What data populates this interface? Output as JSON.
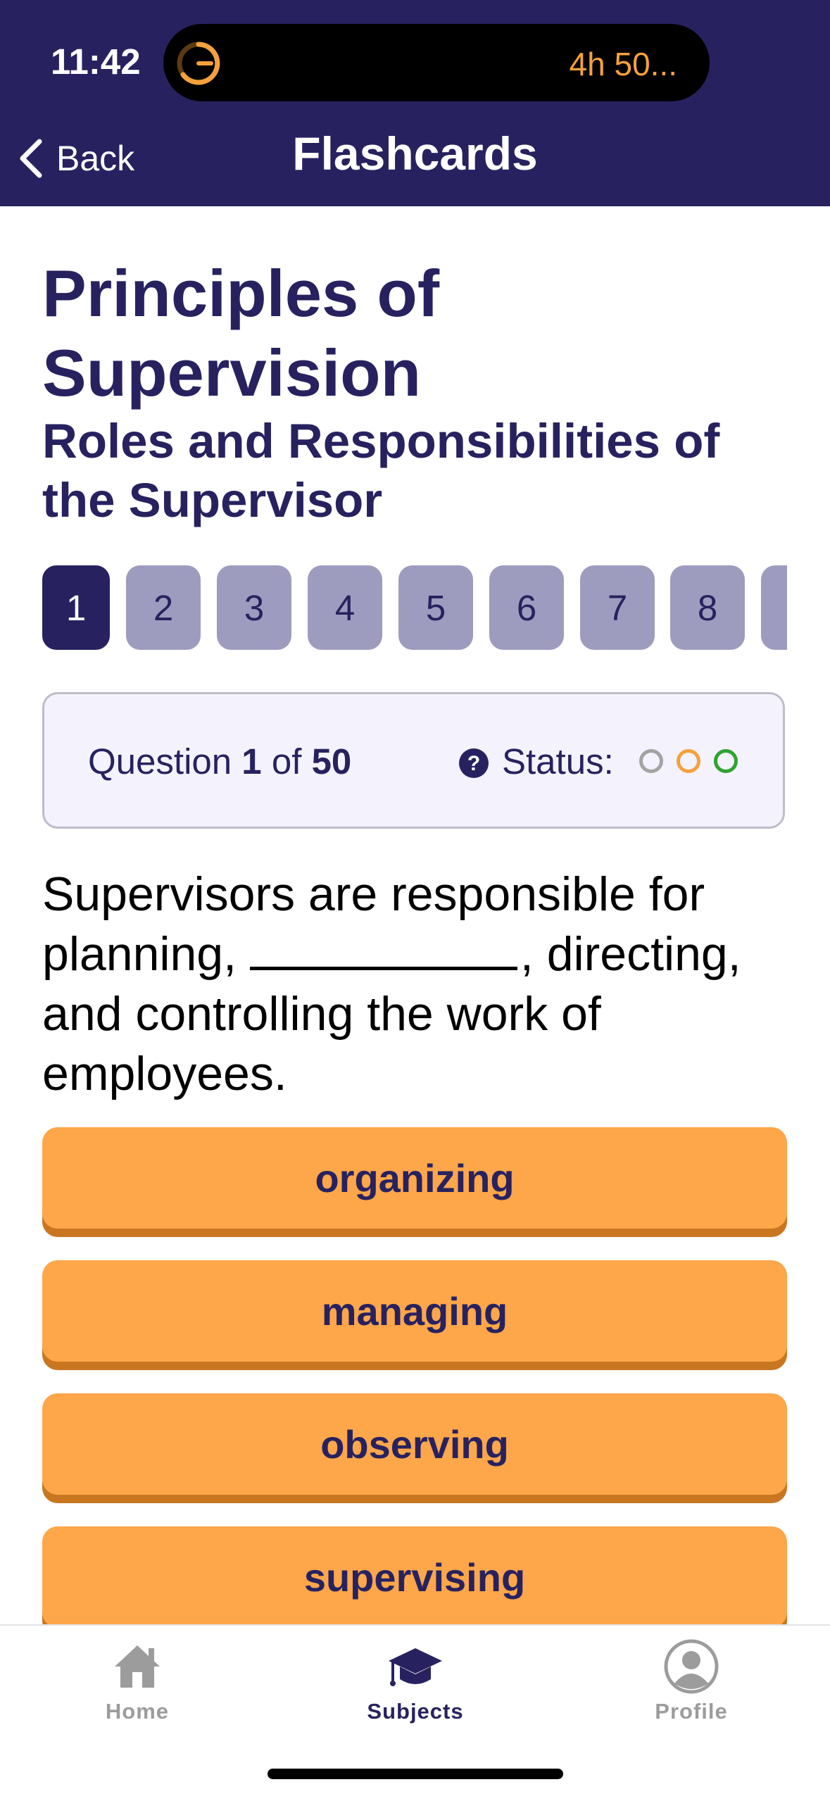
{
  "status_bar": {
    "time": "11:42",
    "activity_text": "4h 50..."
  },
  "nav": {
    "back_label": "Back",
    "title": "Flashcards"
  },
  "subject": "Principles of Supervision",
  "topic": "Roles and Responsibilities of the Supervisor",
  "pager": {
    "pages": [
      "1",
      "2",
      "3",
      "4",
      "5",
      "6",
      "7",
      "8",
      ""
    ],
    "active_index": 0
  },
  "info": {
    "question_word": "Question",
    "current": "1",
    "of_word": "of",
    "total": "50",
    "status_label": "Status:",
    "status_colors": [
      "#a3a3a3",
      "#f4a13d",
      "#2fa32f"
    ]
  },
  "question": {
    "before_blank": "Supervisors are responsible for planning, ",
    "after_blank": ", directing, and controlling the work of employees."
  },
  "answers": [
    "organizing",
    "managing",
    "observing",
    "supervising"
  ],
  "tabs": [
    {
      "label": "Home",
      "icon": "house-icon",
      "active": false
    },
    {
      "label": "Subjects",
      "icon": "graduation-cap-icon",
      "active": true
    },
    {
      "label": "Profile",
      "icon": "user-circle-icon",
      "active": false
    }
  ],
  "colors": {
    "brand": "#27225f",
    "accent": "#fea64a",
    "inactive_page": "#9d9cbf"
  }
}
